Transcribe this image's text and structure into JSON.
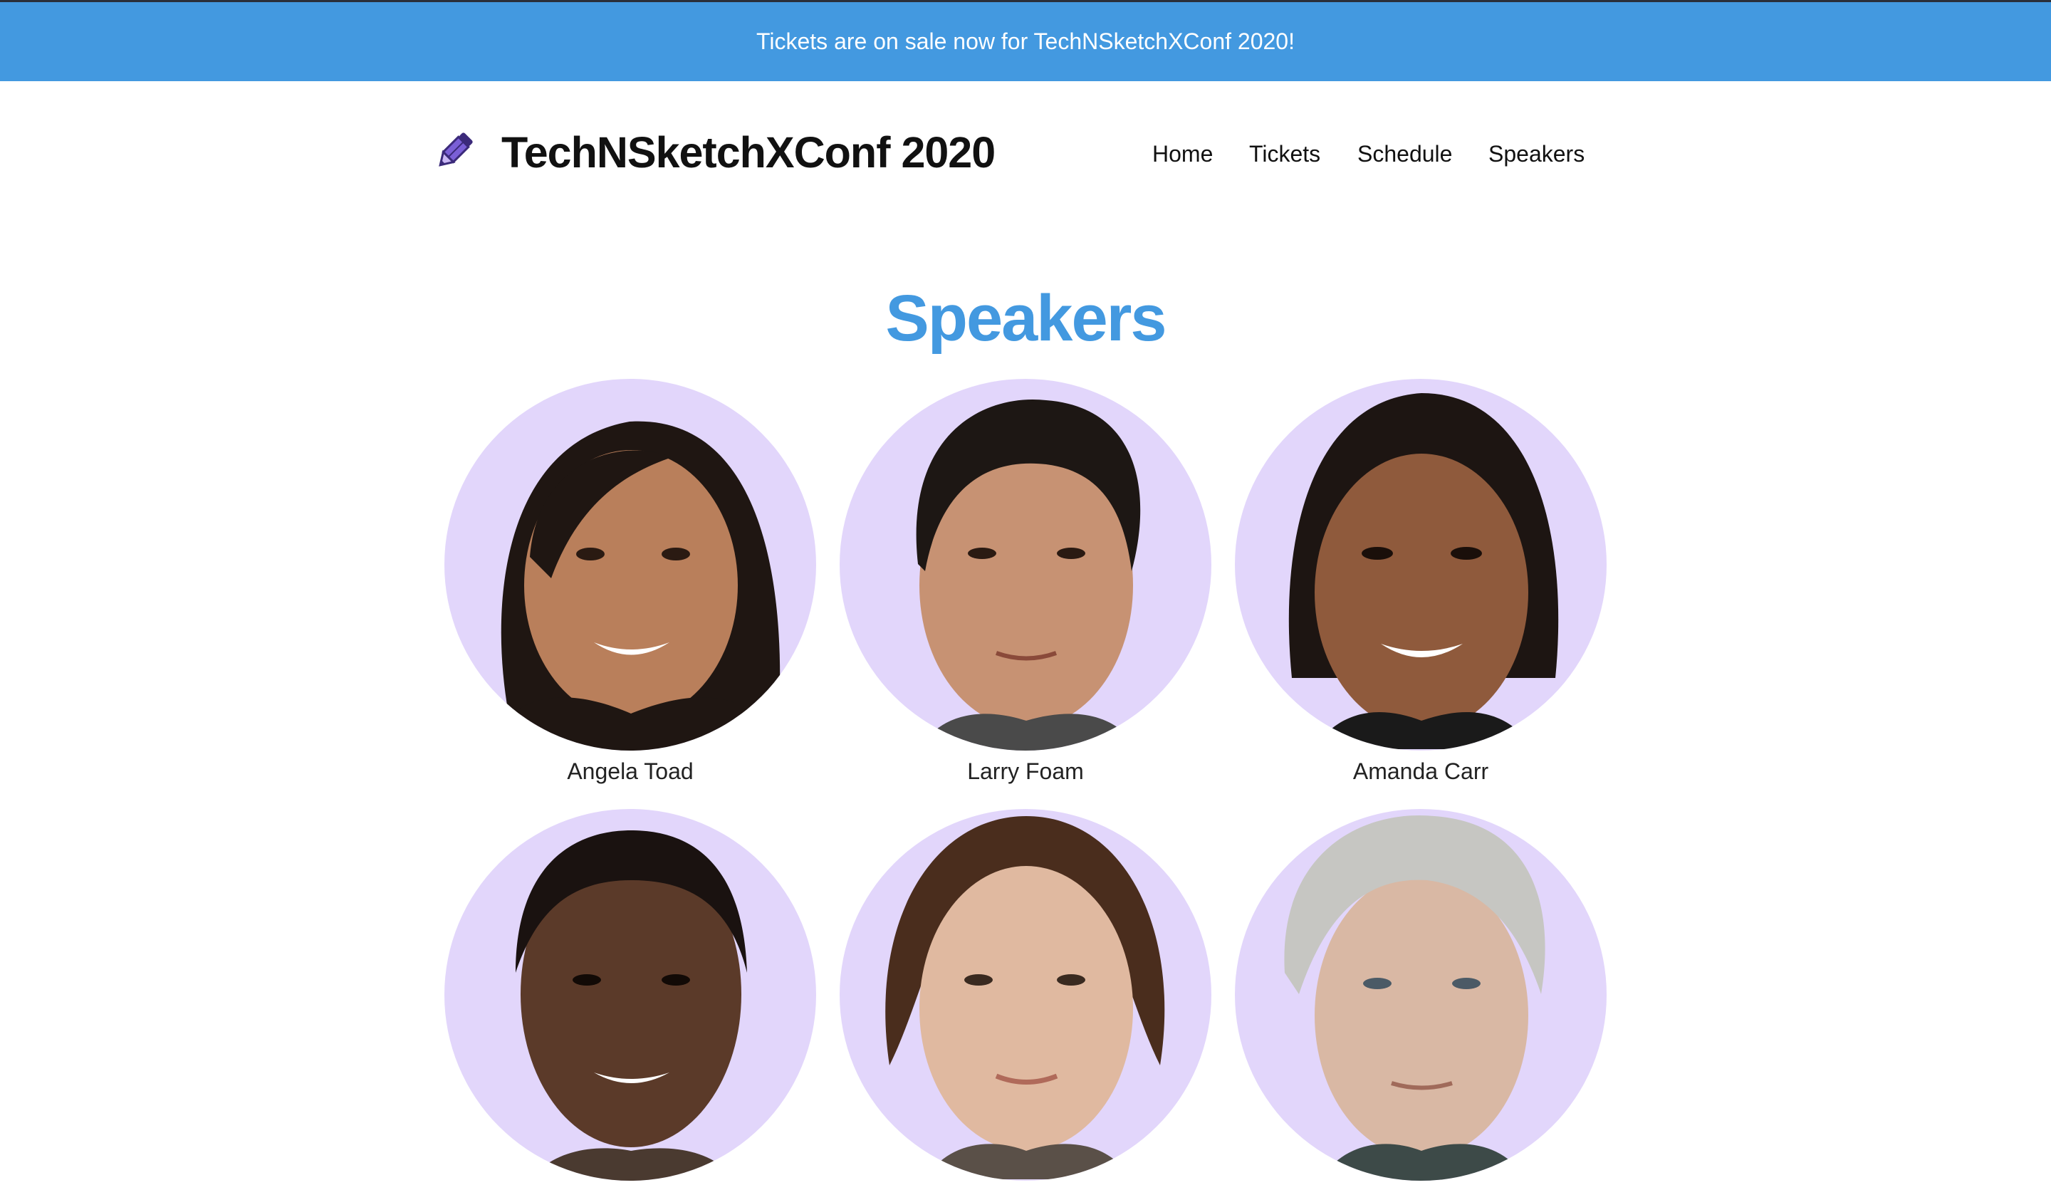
{
  "banner": {
    "text": "Tickets are on sale now for TechNSketchXConf 2020!",
    "color": "#4399e0"
  },
  "header": {
    "logo_icon": "pencil-icon",
    "title": "TechNSketchXConf 2020",
    "nav": [
      {
        "label": "Home"
      },
      {
        "label": "Tickets"
      },
      {
        "label": "Schedule"
      },
      {
        "label": "Speakers"
      }
    ]
  },
  "main": {
    "heading": "Speakers",
    "heading_color": "#4399e0",
    "avatar_background": "#e2d6fb",
    "speakers": [
      {
        "name": "Angela Toad"
      },
      {
        "name": "Larry Foam"
      },
      {
        "name": "Amanda Carr"
      },
      {
        "name": ""
      },
      {
        "name": ""
      },
      {
        "name": ""
      }
    ]
  }
}
